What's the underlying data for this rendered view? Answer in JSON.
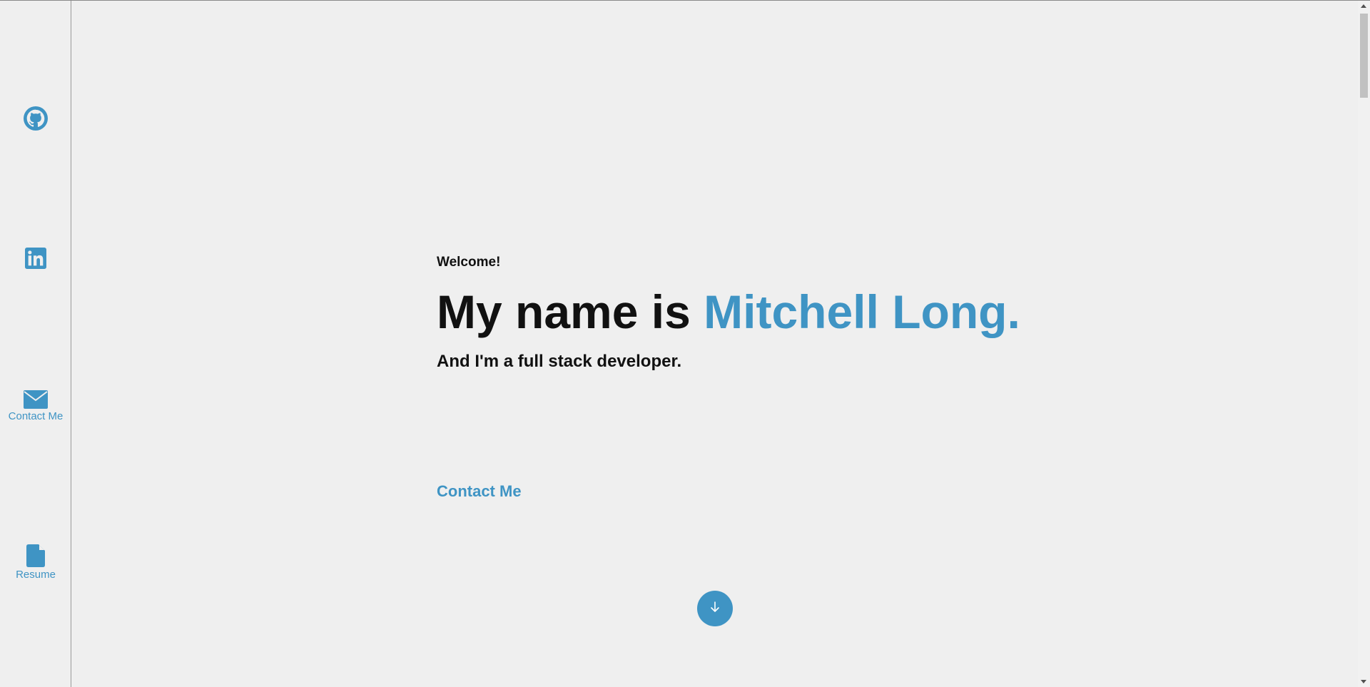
{
  "sidebar": {
    "items": [
      {
        "icon": "github-icon",
        "label": ""
      },
      {
        "icon": "linkedin-icon",
        "label": ""
      },
      {
        "icon": "envelope-icon",
        "label": "Contact Me"
      },
      {
        "icon": "document-icon",
        "label": "Resume"
      }
    ]
  },
  "hero": {
    "welcome": "Welcome!",
    "headline_prefix": "My name is ",
    "headline_name": "Mitchell Long.",
    "subline": "And I'm a full stack developer.",
    "contact_label": "Contact Me"
  },
  "colors": {
    "accent": "#3f94c4",
    "background": "#efefef",
    "text": "#111111"
  },
  "scroll_button": {
    "icon": "arrow-down-icon"
  }
}
